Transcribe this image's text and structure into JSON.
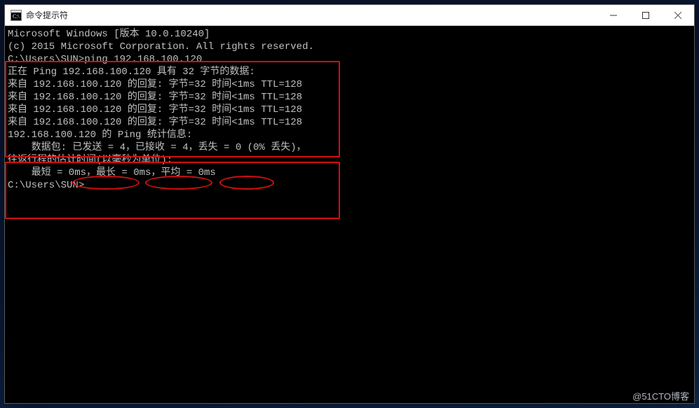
{
  "window": {
    "title": "命令提示符"
  },
  "controls": {
    "minimize": "minimize-icon",
    "maximize": "maximize-icon",
    "close": "close-icon"
  },
  "console": {
    "header1": "Microsoft Windows [版本 10.0.10240]",
    "header2": "(c) 2015 Microsoft Corporation. All rights reserved.",
    "blank": "",
    "prompt_cmd": "C:\\Users\\SUN>ping 192.168.100.120",
    "pinging": "正在 Ping 192.168.100.120 具有 32 字节的数据:",
    "reply1": "来自 192.168.100.120 的回复: 字节=32 时间<1ms TTL=128",
    "reply2": "来自 192.168.100.120 的回复: 字节=32 时间<1ms TTL=128",
    "reply3": "来自 192.168.100.120 的回复: 字节=32 时间<1ms TTL=128",
    "reply4": "来自 192.168.100.120 的回复: 字节=32 时间<1ms TTL=128",
    "stats_hdr": "192.168.100.120 的 Ping 统计信息:",
    "stats_pkts": "    数据包: 已发送 = 4，已接收 = 4，丢失 = 0 (0% 丢失)，",
    "rtt_hdr": "往返行程的估计时间(以毫秒为单位):",
    "rtt_vals": "    最短 = 0ms，最长 = 0ms，平均 = 0ms",
    "prompt_end": "C:\\Users\\SUN>"
  },
  "ping": {
    "host": "192.168.100.120",
    "packet_size": 32,
    "replies": [
      {
        "from": "192.168.100.120",
        "bytes": 32,
        "time": "<1ms",
        "ttl": 128
      },
      {
        "from": "192.168.100.120",
        "bytes": 32,
        "time": "<1ms",
        "ttl": 128
      },
      {
        "from": "192.168.100.120",
        "bytes": 32,
        "time": "<1ms",
        "ttl": 128
      },
      {
        "from": "192.168.100.120",
        "bytes": 32,
        "time": "<1ms",
        "ttl": 128
      }
    ],
    "sent": 4,
    "received": 4,
    "lost": 0,
    "loss_pct": "0%",
    "rtt_min_ms": 0,
    "rtt_max_ms": 0,
    "rtt_avg_ms": 0
  },
  "colors": {
    "fg": "#c0c0c0",
    "bg": "#000000",
    "annotation": "#d20f0f",
    "titlebar_bg": "#ffffff"
  },
  "watermark": "@51CTO博客"
}
